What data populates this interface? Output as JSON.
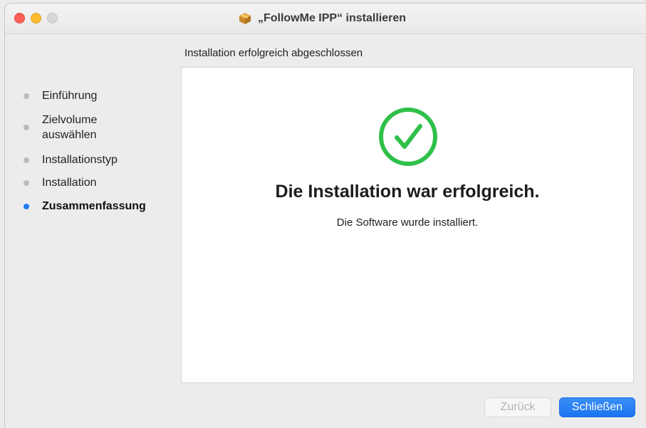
{
  "window": {
    "title": "„FollowMe IPP“ installieren",
    "icon": "package-icon"
  },
  "step_heading": "Installation erfolgreich abgeschlossen",
  "sidebar": {
    "items": [
      {
        "label": "Einführung",
        "active": false
      },
      {
        "label": "Zielvolume auswählen",
        "active": false
      },
      {
        "label": "Installationstyp",
        "active": false
      },
      {
        "label": "Installation",
        "active": false
      },
      {
        "label": "Zusammenfassung",
        "active": true
      }
    ]
  },
  "content": {
    "icon": "checkmark-circle-icon",
    "title": "Die Installation war erfolgreich.",
    "subtitle": "Die Software wurde installiert."
  },
  "buttons": {
    "back_label": "Zurück",
    "close_label": "Schließen"
  },
  "colors": {
    "accent": "#1f7cf0",
    "success": "#2fc04a",
    "close": "#fe5f57",
    "minimize": "#febc2e",
    "zoom_inactive": "#d6d6d6"
  }
}
